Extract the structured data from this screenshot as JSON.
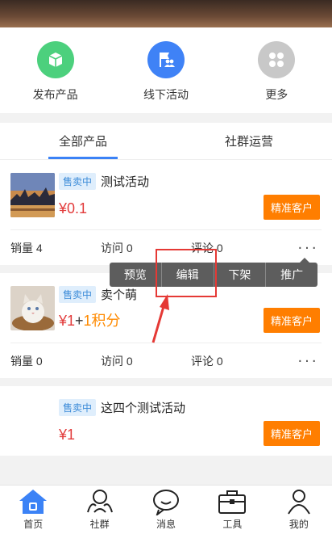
{
  "quick_actions": [
    {
      "label": "发布产品",
      "icon": "box-icon",
      "color": "#4cd07d"
    },
    {
      "label": "线下活动",
      "icon": "people-flag-icon",
      "color": "#3f82f6"
    },
    {
      "label": "更多",
      "icon": "clover-icon",
      "color": "#c8c8c8"
    }
  ],
  "tabs": [
    {
      "label": "全部产品",
      "active": true
    },
    {
      "label": "社群运营",
      "active": false
    }
  ],
  "products": [
    {
      "badge": "售卖中",
      "title": "测试活动",
      "price": "¥0.1",
      "tag": "精准客户",
      "sales": "销量 4",
      "visits": "访问 0",
      "comments": "评论 0",
      "thumb": "city-night"
    },
    {
      "badge": "售卖中",
      "title": "卖个萌",
      "price_main": "¥1",
      "price_plus": "+",
      "price_points": "1积分",
      "tag": "精准客户",
      "sales": "销量 0",
      "visits": "访问 0",
      "comments": "评论 0",
      "thumb": "cat"
    },
    {
      "badge": "售卖中",
      "title": "这四个测试活动",
      "price": "¥1",
      "tag": "精准客户",
      "thumb": "blank"
    }
  ],
  "popup_menu": [
    "预览",
    "编辑",
    "下架",
    "推广"
  ],
  "more_glyph": "···",
  "tabbar": [
    {
      "label": "首页",
      "icon": "home-icon",
      "active": true
    },
    {
      "label": "社群",
      "icon": "community-icon"
    },
    {
      "label": "消息",
      "icon": "message-icon"
    },
    {
      "label": "工具",
      "icon": "toolbox-icon"
    },
    {
      "label": "我的",
      "icon": "profile-icon"
    }
  ],
  "colors": {
    "accent": "#3b82f6",
    "price": "#e23b3b",
    "tag": "#ff7e00",
    "annotation": "#e53935"
  }
}
